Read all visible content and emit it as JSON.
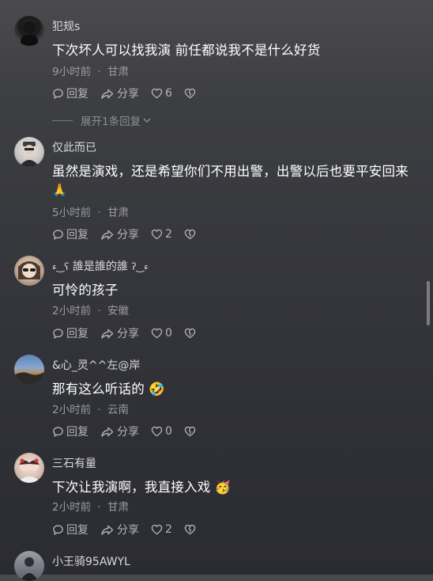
{
  "comments": [
    {
      "username": "犯规s",
      "text": "下次坏人可以找我演 前任都说我不是什么好货",
      "time": "9小时前",
      "location": "甘肃",
      "reply_label": "回复",
      "share_label": "分享",
      "likes": "6",
      "expand_label": "展开1条回复"
    },
    {
      "username": "仅此而已",
      "text": "虽然是演戏，还是希望你们不用出警，出警以后也要平安回来",
      "text2": "🙏",
      "time": "5小时前",
      "location": "甘肃",
      "reply_label": "回复",
      "share_label": "分享",
      "likes": "2"
    },
    {
      "username": "誰是誰的誰",
      "text": "可怜的孩子",
      "time": "2小时前",
      "location": "安徽",
      "reply_label": "回复",
      "share_label": "分享",
      "likes": "0"
    },
    {
      "username": "&心_灵^^左@岸",
      "text": "那有这么听话的 🤣",
      "time": "2小时前",
      "location": "云南",
      "reply_label": "回复",
      "share_label": "分享",
      "likes": "0"
    },
    {
      "username": "三石有量",
      "text": "下次让我演啊，我直接入戏 🥳",
      "time": "2小时前",
      "location": "甘肃",
      "reply_label": "回复",
      "share_label": "分享",
      "likes": "2"
    },
    {
      "username": "小王骑95AWYL"
    }
  ],
  "separator": "·",
  "icons": {
    "reply": "reply-bubble-icon",
    "share": "share-arrow-icon",
    "like": "heart-icon",
    "dislike": "broken-heart-icon"
  }
}
